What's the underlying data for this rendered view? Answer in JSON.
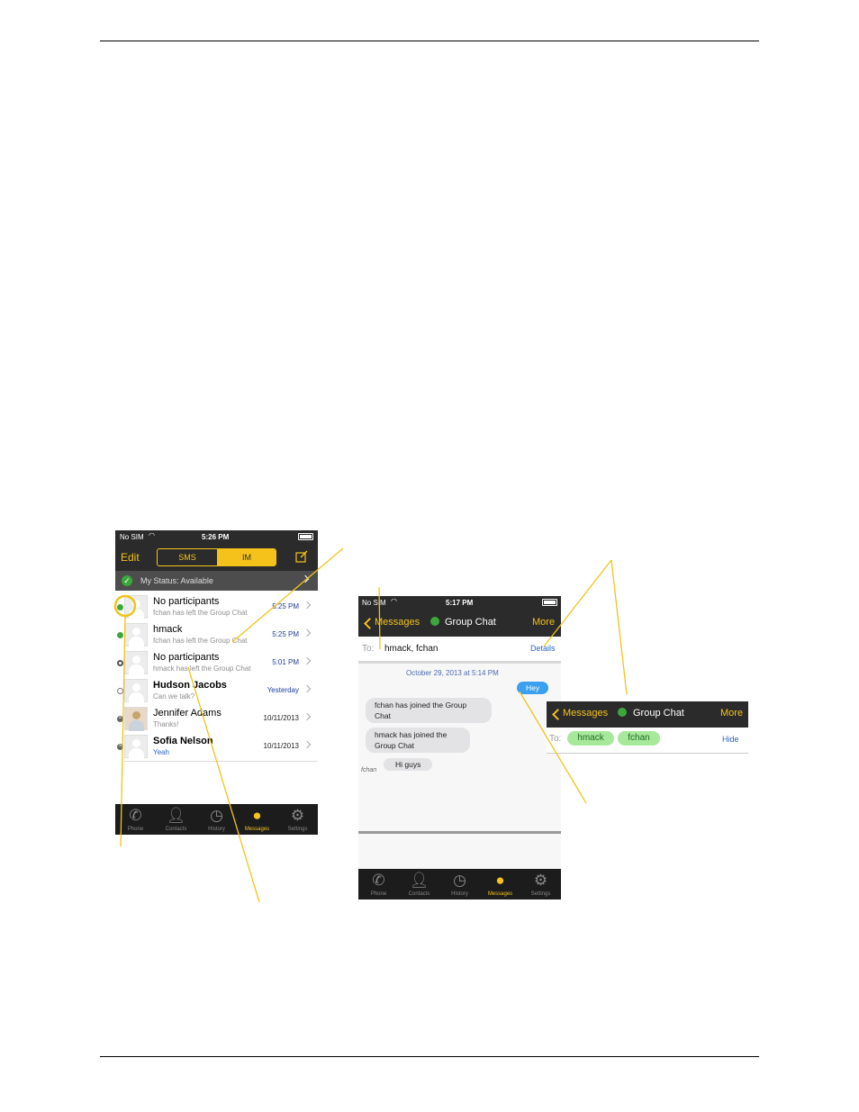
{
  "left_screen": {
    "status": {
      "carrier": "No SIM",
      "time": "5:26 PM"
    },
    "nav": {
      "edit": "Edit",
      "segments": [
        "SMS",
        "IM"
      ],
      "active_segment": "IM"
    },
    "my_status": "My Status: Available",
    "conversations": [
      {
        "name": "No participants",
        "preview": "fchan has left the Group Chat",
        "time": "5:25 PM",
        "status": "group-chat"
      },
      {
        "name": "hmack",
        "preview": "fchan has left the Group Chat",
        "time": "5:25 PM",
        "status": "group-chat"
      },
      {
        "name": "No participants",
        "preview": "hmack has left the Group Chat",
        "time": "5:01 PM",
        "status": "group-chat-offline"
      },
      {
        "name": "Hudson Jacobs",
        "preview": "Can we talk?",
        "time": "Yesterday",
        "status": "offline"
      },
      {
        "name": "Jennifer Adams",
        "preview": "Thanks!",
        "time": "10/11/2013",
        "status": "unavailable"
      },
      {
        "name": "Sofia Nelson",
        "preview": "Yeah",
        "time": "10/11/2013",
        "status": "unavailable"
      }
    ],
    "tabs": [
      "Phone",
      "Contacts",
      "History",
      "Messages",
      "Settings"
    ],
    "active_tab": "Messages"
  },
  "right_screen": {
    "status": {
      "carrier": "No SIM",
      "time": "5:17 PM"
    },
    "nav": {
      "back": "Messages",
      "title": "Group Chat",
      "more": "More"
    },
    "to": {
      "label": "To:",
      "value": "hmack, fchan",
      "details": "Details"
    },
    "date_stamp": "October 29, 2013 at 5:14 PM",
    "messages": [
      {
        "from": "me",
        "text": "Hey"
      },
      {
        "from": "system",
        "text": "fchan has joined the Group Chat"
      },
      {
        "from": "system",
        "text": "hmack has joined the Group Chat"
      },
      {
        "from": "fchan",
        "text": "Hi guys"
      }
    ],
    "sender_label": "fchan",
    "tabs": [
      "Phone",
      "Contacts",
      "History",
      "Messages",
      "Settings"
    ],
    "active_tab": "Messages"
  },
  "detail_inset": {
    "nav": {
      "back": "Messages",
      "title": "Group Chat",
      "more": "More"
    },
    "to_label": "To:",
    "participants": [
      "hmack",
      "fchan"
    ],
    "hide": "Hide"
  },
  "colors": {
    "accent": "#f4c21b",
    "nav_bg": "#2b2b2b",
    "tab_bg": "#1c1c1c",
    "bubble_blue": "#3aa0f0",
    "online_green": "#3ca83c",
    "pill_green": "#a8e89b",
    "callout": "#f0c419"
  }
}
